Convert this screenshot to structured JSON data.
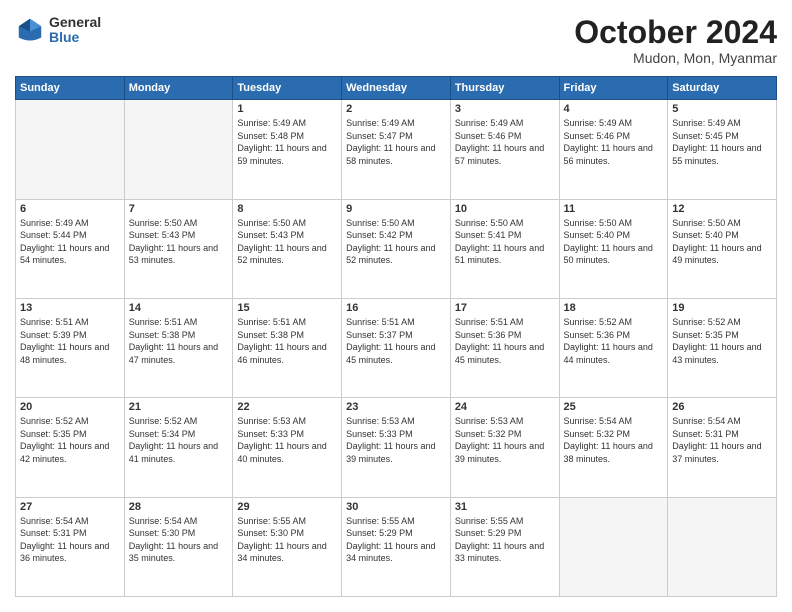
{
  "header": {
    "logo_general": "General",
    "logo_blue": "Blue",
    "month_title": "October 2024",
    "subtitle": "Mudon, Mon, Myanmar"
  },
  "days_of_week": [
    "Sunday",
    "Monday",
    "Tuesday",
    "Wednesday",
    "Thursday",
    "Friday",
    "Saturday"
  ],
  "weeks": [
    [
      {
        "day": "",
        "sunrise": "",
        "sunset": "",
        "daylight": ""
      },
      {
        "day": "",
        "sunrise": "",
        "sunset": "",
        "daylight": ""
      },
      {
        "day": "1",
        "sunrise": "Sunrise: 5:49 AM",
        "sunset": "Sunset: 5:48 PM",
        "daylight": "Daylight: 11 hours and 59 minutes."
      },
      {
        "day": "2",
        "sunrise": "Sunrise: 5:49 AM",
        "sunset": "Sunset: 5:47 PM",
        "daylight": "Daylight: 11 hours and 58 minutes."
      },
      {
        "day": "3",
        "sunrise": "Sunrise: 5:49 AM",
        "sunset": "Sunset: 5:46 PM",
        "daylight": "Daylight: 11 hours and 57 minutes."
      },
      {
        "day": "4",
        "sunrise": "Sunrise: 5:49 AM",
        "sunset": "Sunset: 5:46 PM",
        "daylight": "Daylight: 11 hours and 56 minutes."
      },
      {
        "day": "5",
        "sunrise": "Sunrise: 5:49 AM",
        "sunset": "Sunset: 5:45 PM",
        "daylight": "Daylight: 11 hours and 55 minutes."
      }
    ],
    [
      {
        "day": "6",
        "sunrise": "Sunrise: 5:49 AM",
        "sunset": "Sunset: 5:44 PM",
        "daylight": "Daylight: 11 hours and 54 minutes."
      },
      {
        "day": "7",
        "sunrise": "Sunrise: 5:50 AM",
        "sunset": "Sunset: 5:43 PM",
        "daylight": "Daylight: 11 hours and 53 minutes."
      },
      {
        "day": "8",
        "sunrise": "Sunrise: 5:50 AM",
        "sunset": "Sunset: 5:43 PM",
        "daylight": "Daylight: 11 hours and 52 minutes."
      },
      {
        "day": "9",
        "sunrise": "Sunrise: 5:50 AM",
        "sunset": "Sunset: 5:42 PM",
        "daylight": "Daylight: 11 hours and 52 minutes."
      },
      {
        "day": "10",
        "sunrise": "Sunrise: 5:50 AM",
        "sunset": "Sunset: 5:41 PM",
        "daylight": "Daylight: 11 hours and 51 minutes."
      },
      {
        "day": "11",
        "sunrise": "Sunrise: 5:50 AM",
        "sunset": "Sunset: 5:40 PM",
        "daylight": "Daylight: 11 hours and 50 minutes."
      },
      {
        "day": "12",
        "sunrise": "Sunrise: 5:50 AM",
        "sunset": "Sunset: 5:40 PM",
        "daylight": "Daylight: 11 hours and 49 minutes."
      }
    ],
    [
      {
        "day": "13",
        "sunrise": "Sunrise: 5:51 AM",
        "sunset": "Sunset: 5:39 PM",
        "daylight": "Daylight: 11 hours and 48 minutes."
      },
      {
        "day": "14",
        "sunrise": "Sunrise: 5:51 AM",
        "sunset": "Sunset: 5:38 PM",
        "daylight": "Daylight: 11 hours and 47 minutes."
      },
      {
        "day": "15",
        "sunrise": "Sunrise: 5:51 AM",
        "sunset": "Sunset: 5:38 PM",
        "daylight": "Daylight: 11 hours and 46 minutes."
      },
      {
        "day": "16",
        "sunrise": "Sunrise: 5:51 AM",
        "sunset": "Sunset: 5:37 PM",
        "daylight": "Daylight: 11 hours and 45 minutes."
      },
      {
        "day": "17",
        "sunrise": "Sunrise: 5:51 AM",
        "sunset": "Sunset: 5:36 PM",
        "daylight": "Daylight: 11 hours and 45 minutes."
      },
      {
        "day": "18",
        "sunrise": "Sunrise: 5:52 AM",
        "sunset": "Sunset: 5:36 PM",
        "daylight": "Daylight: 11 hours and 44 minutes."
      },
      {
        "day": "19",
        "sunrise": "Sunrise: 5:52 AM",
        "sunset": "Sunset: 5:35 PM",
        "daylight": "Daylight: 11 hours and 43 minutes."
      }
    ],
    [
      {
        "day": "20",
        "sunrise": "Sunrise: 5:52 AM",
        "sunset": "Sunset: 5:35 PM",
        "daylight": "Daylight: 11 hours and 42 minutes."
      },
      {
        "day": "21",
        "sunrise": "Sunrise: 5:52 AM",
        "sunset": "Sunset: 5:34 PM",
        "daylight": "Daylight: 11 hours and 41 minutes."
      },
      {
        "day": "22",
        "sunrise": "Sunrise: 5:53 AM",
        "sunset": "Sunset: 5:33 PM",
        "daylight": "Daylight: 11 hours and 40 minutes."
      },
      {
        "day": "23",
        "sunrise": "Sunrise: 5:53 AM",
        "sunset": "Sunset: 5:33 PM",
        "daylight": "Daylight: 11 hours and 39 minutes."
      },
      {
        "day": "24",
        "sunrise": "Sunrise: 5:53 AM",
        "sunset": "Sunset: 5:32 PM",
        "daylight": "Daylight: 11 hours and 39 minutes."
      },
      {
        "day": "25",
        "sunrise": "Sunrise: 5:54 AM",
        "sunset": "Sunset: 5:32 PM",
        "daylight": "Daylight: 11 hours and 38 minutes."
      },
      {
        "day": "26",
        "sunrise": "Sunrise: 5:54 AM",
        "sunset": "Sunset: 5:31 PM",
        "daylight": "Daylight: 11 hours and 37 minutes."
      }
    ],
    [
      {
        "day": "27",
        "sunrise": "Sunrise: 5:54 AM",
        "sunset": "Sunset: 5:31 PM",
        "daylight": "Daylight: 11 hours and 36 minutes."
      },
      {
        "day": "28",
        "sunrise": "Sunrise: 5:54 AM",
        "sunset": "Sunset: 5:30 PM",
        "daylight": "Daylight: 11 hours and 35 minutes."
      },
      {
        "day": "29",
        "sunrise": "Sunrise: 5:55 AM",
        "sunset": "Sunset: 5:30 PM",
        "daylight": "Daylight: 11 hours and 34 minutes."
      },
      {
        "day": "30",
        "sunrise": "Sunrise: 5:55 AM",
        "sunset": "Sunset: 5:29 PM",
        "daylight": "Daylight: 11 hours and 34 minutes."
      },
      {
        "day": "31",
        "sunrise": "Sunrise: 5:55 AM",
        "sunset": "Sunset: 5:29 PM",
        "daylight": "Daylight: 11 hours and 33 minutes."
      },
      {
        "day": "",
        "sunrise": "",
        "sunset": "",
        "daylight": ""
      },
      {
        "day": "",
        "sunrise": "",
        "sunset": "",
        "daylight": ""
      }
    ]
  ]
}
